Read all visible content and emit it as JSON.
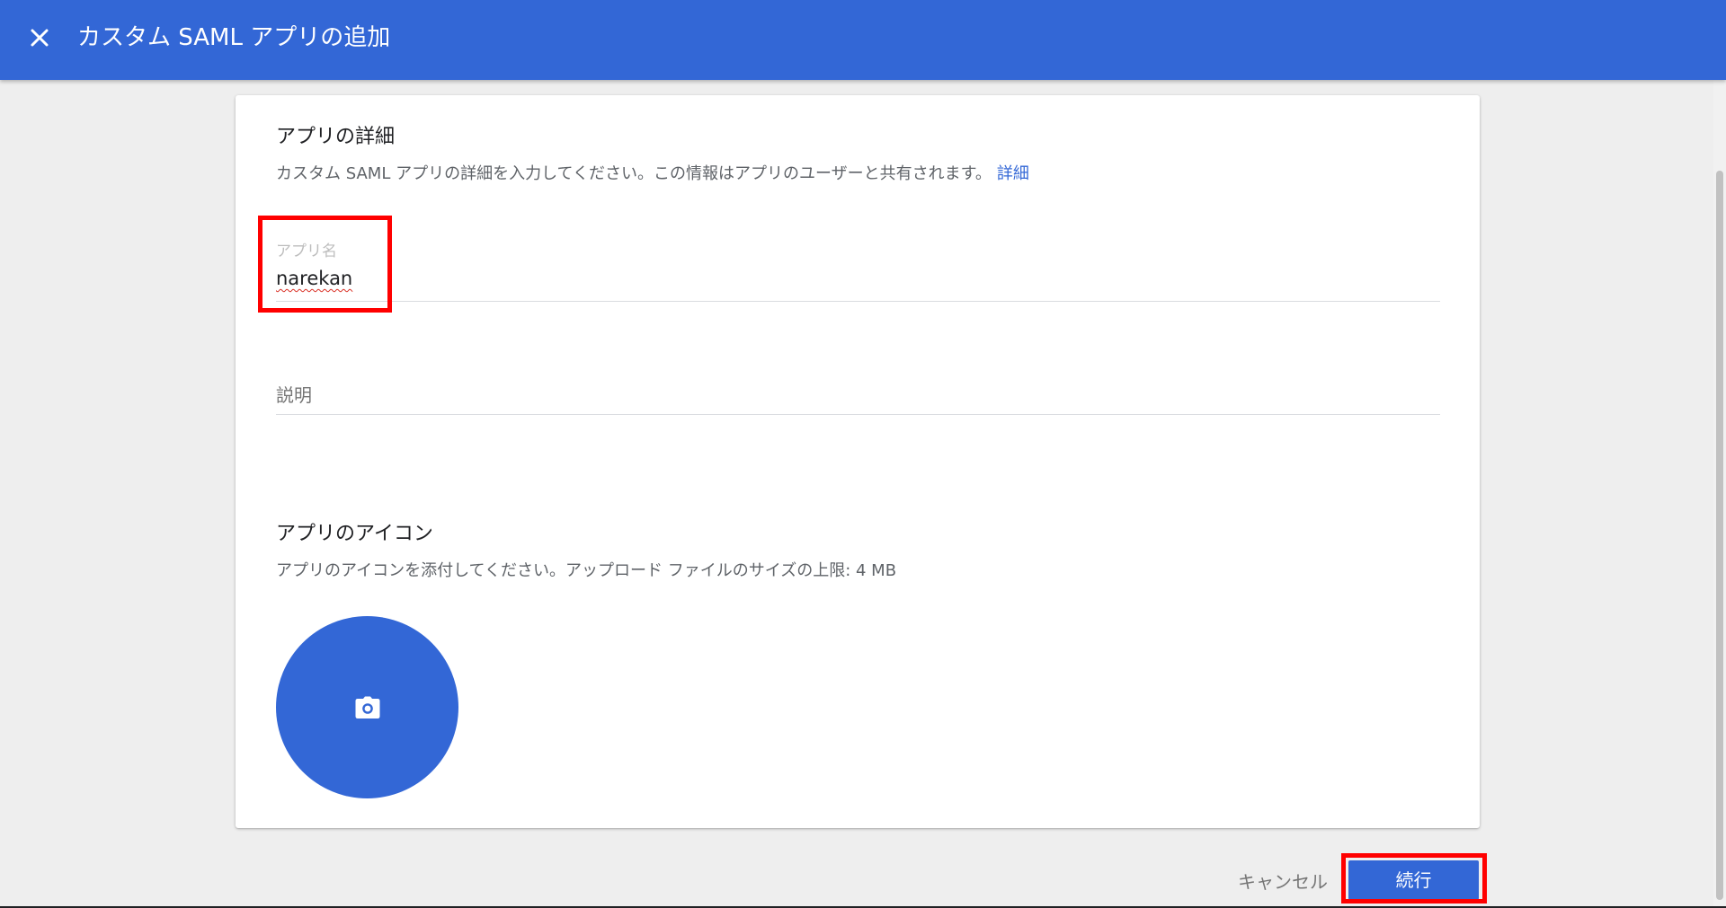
{
  "header": {
    "title": "カスタム SAML アプリの追加",
    "close_icon": "close-icon",
    "background_color": "#3367d6"
  },
  "app_details": {
    "title": "アプリの詳細",
    "description": "カスタム SAML アプリの詳細を入力してください。この情報はアプリのユーザーと共有されます。",
    "learn_more_link": "詳細",
    "app_name_label": "アプリ名",
    "app_name_value": "narekan",
    "description_placeholder": "説明",
    "description_value": ""
  },
  "app_icon": {
    "title": "アプリのアイコン",
    "description": "アプリのアイコンを添付してください。アップロード ファイルのサイズの上限: 4 MB",
    "upload_icon": "camera-icon"
  },
  "footer": {
    "cancel_label": "キャンセル",
    "continue_label": "続行"
  },
  "colors": {
    "accent": "#3367d6",
    "highlight": "#ff0000"
  }
}
